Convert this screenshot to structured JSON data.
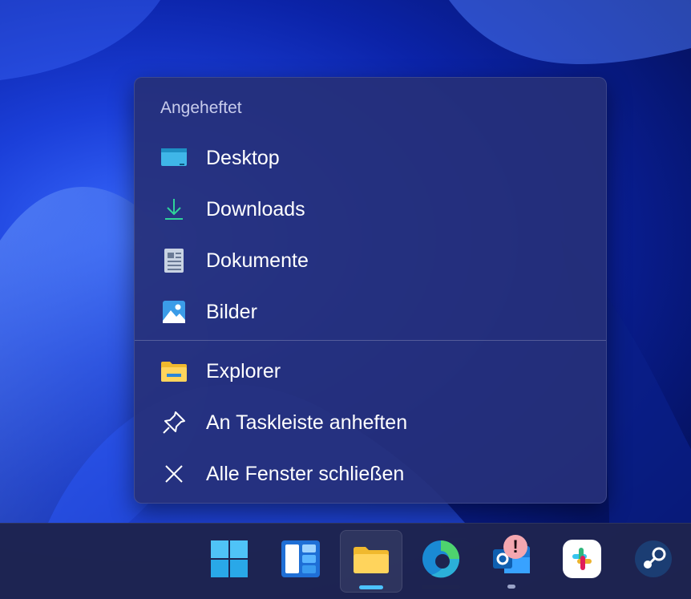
{
  "menu": {
    "section_title": "Angeheftet",
    "pinned": [
      {
        "label": "Desktop",
        "icon": "desktop-folder-icon"
      },
      {
        "label": "Downloads",
        "icon": "download-arrow-icon"
      },
      {
        "label": "Dokumente",
        "icon": "document-icon"
      },
      {
        "label": "Bilder",
        "icon": "pictures-icon"
      }
    ],
    "actions": [
      {
        "label": "Explorer",
        "icon": "file-explorer-icon"
      },
      {
        "label": "An Taskleiste anheften",
        "icon": "pin-icon"
      },
      {
        "label": "Alle Fenster schließen",
        "icon": "close-icon"
      }
    ]
  },
  "taskbar": {
    "apps": [
      "start-windows-icon",
      "widgets-icon",
      "file-explorer-icon",
      "edge-icon",
      "outlook-icon",
      "slack-icon",
      "steam-icon"
    ],
    "active_app": "file-explorer-icon",
    "outlook_badge": "!"
  },
  "colors": {
    "menu_bg": "#263078",
    "accent_indicator": "#4cc2ff",
    "badge": "#f4a7b0"
  }
}
